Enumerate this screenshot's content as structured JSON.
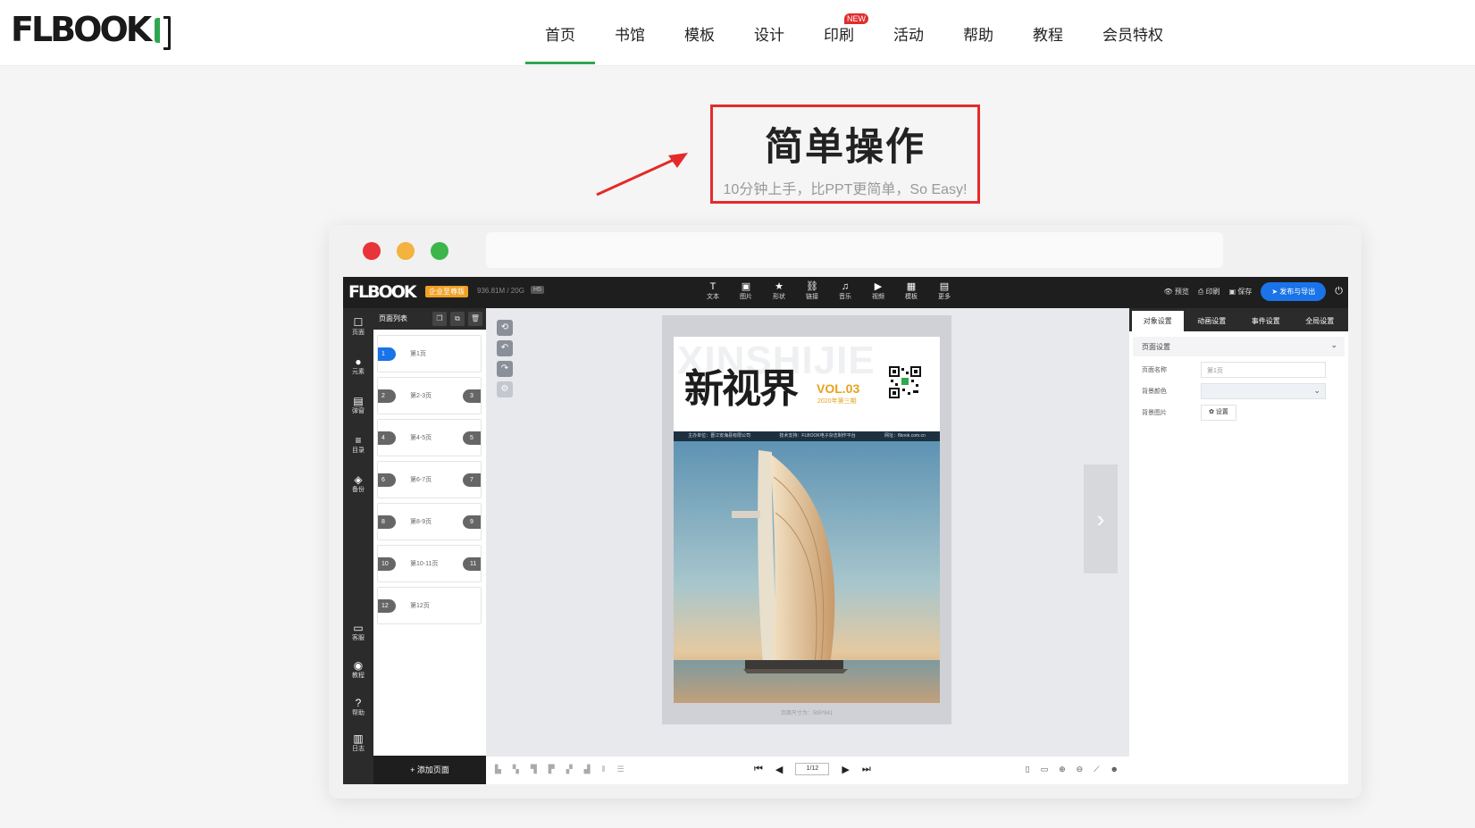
{
  "site": {
    "logo_text": "FLBOOK",
    "nav": [
      {
        "label": "首页",
        "active": true
      },
      {
        "label": "书馆"
      },
      {
        "label": "模板"
      },
      {
        "label": "设计"
      },
      {
        "label": "印刷",
        "badge": "NEW"
      },
      {
        "label": "活动"
      },
      {
        "label": "帮助"
      },
      {
        "label": "教程"
      },
      {
        "label": "会员特权"
      }
    ]
  },
  "hero": {
    "title": "简单操作",
    "subtitle": "10分钟上手，比PPT更简单，So Easy!"
  },
  "window": {
    "dots": [
      "#e8333a",
      "#f4b23e",
      "#3cb64a"
    ]
  },
  "editor": {
    "logo_text": "FLBOOK",
    "edition_badge": "企业至尊版",
    "storage": "936.81M / 20G",
    "version_badge": "H5",
    "tools": [
      {
        "icon": "T",
        "label": "文本"
      },
      {
        "icon": "▣",
        "label": "图片"
      },
      {
        "icon": "★",
        "label": "形状"
      },
      {
        "icon": "⛓",
        "label": "链接"
      },
      {
        "icon": "♫",
        "label": "音乐"
      },
      {
        "icon": "▶",
        "label": "视频"
      },
      {
        "icon": "▦",
        "label": "模板"
      },
      {
        "icon": "▤",
        "label": "更多"
      }
    ],
    "top_right": {
      "preview": "预览",
      "print": "印刷",
      "save": "保存",
      "publish": "发布与导出"
    },
    "sidebar": [
      {
        "icon": "☐",
        "label": "页面"
      },
      {
        "icon": "●",
        "label": "元素"
      },
      {
        "icon": "▤",
        "label": "弹窗"
      },
      {
        "icon": "≡",
        "label": "目录"
      },
      {
        "icon": "◈",
        "label": "备份"
      },
      {
        "icon": "▭",
        "label": "客服"
      },
      {
        "icon": "◉",
        "label": "教程"
      },
      {
        "icon": "?",
        "label": "帮助"
      },
      {
        "icon": "▥",
        "label": "日志"
      }
    ],
    "pagelist": {
      "header": "页面列表",
      "pages": [
        {
          "num": "1",
          "label": "第1页",
          "right": ""
        },
        {
          "num": "2",
          "label": "第2-3页",
          "right": "3"
        },
        {
          "num": "4",
          "label": "第4-5页",
          "right": "5"
        },
        {
          "num": "6",
          "label": "第6-7页",
          "right": "7"
        },
        {
          "num": "8",
          "label": "第8-9页",
          "right": "9"
        },
        {
          "num": "10",
          "label": "第10-11页",
          "right": "11"
        },
        {
          "num": "12",
          "label": "第12页",
          "right": ""
        }
      ],
      "add_page": "+ 添加页面"
    },
    "magazine": {
      "bg_text": "XINSHIJIE",
      "title": "新视界",
      "vol": "VOL.03",
      "date": "2020年第三期",
      "band": [
        "主办单位：晋江安海县有限公司",
        "技术支持：FLBOOK电子杂志制作平台",
        "网址：flbook.com.cn"
      ],
      "page_size": "页面尺寸为：595*841"
    },
    "right_panel": {
      "tabs": [
        "对象设置",
        "动画设置",
        "事件设置",
        "全局设置"
      ],
      "section": "页面设置",
      "page_name_label": "页面名称",
      "page_name_value": "第1页",
      "bg_color_label": "背景颜色",
      "bg_image_label": "背景图片",
      "bg_image_button": "✿ 设置"
    },
    "bottom": {
      "page_indicator": "1/12"
    }
  }
}
